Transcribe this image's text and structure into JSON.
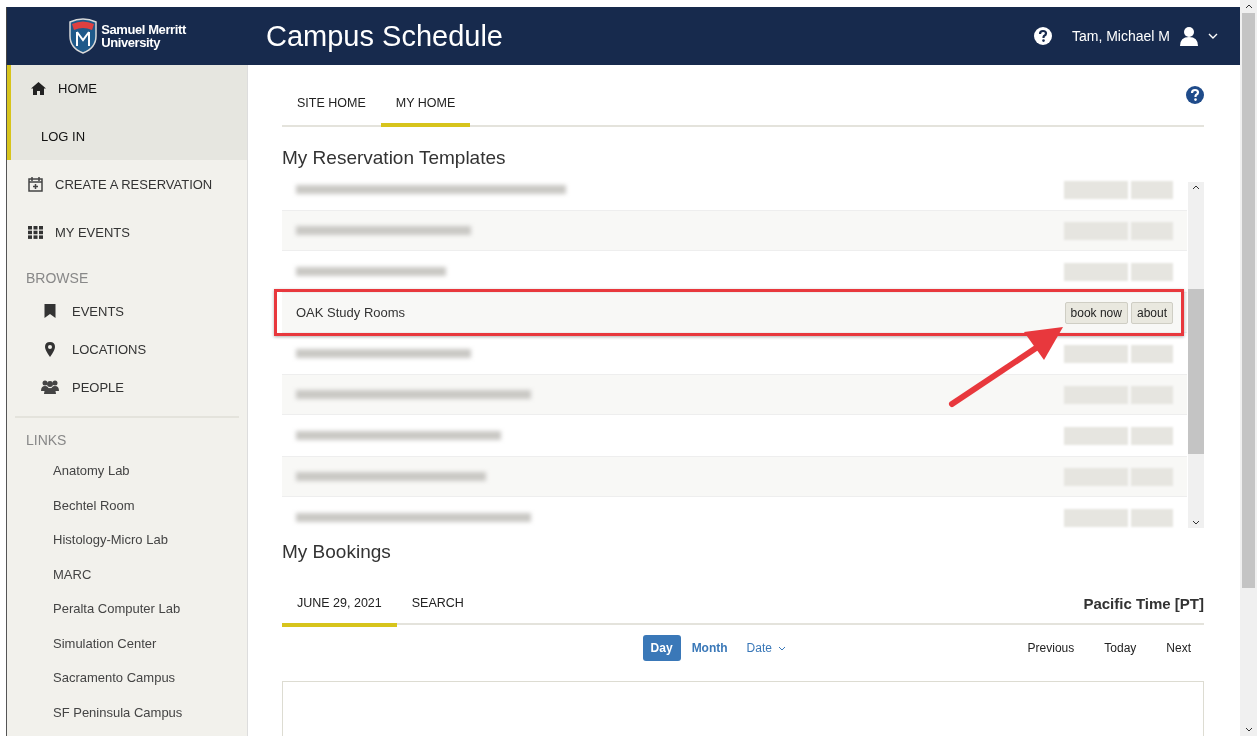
{
  "header": {
    "logo_line_1": "Samuel Merritt",
    "logo_line_2": "University",
    "title": "Campus Schedule",
    "user": "Tam, Michael M"
  },
  "sidebar": {
    "main_items": [
      {
        "label": "HOME",
        "active": true
      },
      {
        "label": "LOG IN",
        "active": true
      },
      {
        "label": "CREATE A RESERVATION",
        "active": false
      },
      {
        "label": "MY EVENTS",
        "active": false
      }
    ],
    "browse": {
      "heading": "BROWSE",
      "items": [
        {
          "label": "EVENTS"
        },
        {
          "label": "LOCATIONS"
        },
        {
          "label": "PEOPLE"
        }
      ]
    },
    "links": {
      "heading": "LINKS",
      "items": [
        "Anatomy Lab",
        "Bechtel Room",
        "Histology-Micro Lab",
        "MARC",
        "Peralta Computer Lab",
        "Simulation Center",
        "Sacramento Campus",
        "SF Peninsula Campus"
      ]
    }
  },
  "tabs": [
    {
      "label": "SITE HOME",
      "selected": false
    },
    {
      "label": "MY HOME",
      "selected": true
    }
  ],
  "templates": {
    "title": "My Reservation Templates",
    "rows": [
      {
        "kind": "blurred",
        "highlighted": false
      },
      {
        "kind": "blurred",
        "highlighted": false
      },
      {
        "kind": "blurred",
        "highlighted": false
      },
      {
        "kind": "visible",
        "name": "OAK Study Rooms",
        "book_label": "book now",
        "about_label": "about",
        "highlighted": true
      },
      {
        "kind": "blurred",
        "highlighted": false
      },
      {
        "kind": "blurred",
        "highlighted": false
      },
      {
        "kind": "blurred",
        "highlighted": false
      },
      {
        "kind": "blurred",
        "highlighted": false
      },
      {
        "kind": "blurred",
        "highlighted": false
      }
    ]
  },
  "bookings": {
    "title": "My Bookings",
    "tabs": [
      {
        "label": "JUNE 29, 2021",
        "selected": true
      },
      {
        "label": "SEARCH",
        "selected": false
      }
    ],
    "timezone": "Pacific Time [PT]",
    "views": [
      {
        "label": "Day",
        "kind": "button",
        "selected": true
      },
      {
        "label": "Month",
        "kind": "button",
        "selected": false
      },
      {
        "label": "Date",
        "kind": "dropdown",
        "selected": false
      }
    ],
    "nav": [
      "Previous",
      "Today",
      "Next"
    ]
  }
}
